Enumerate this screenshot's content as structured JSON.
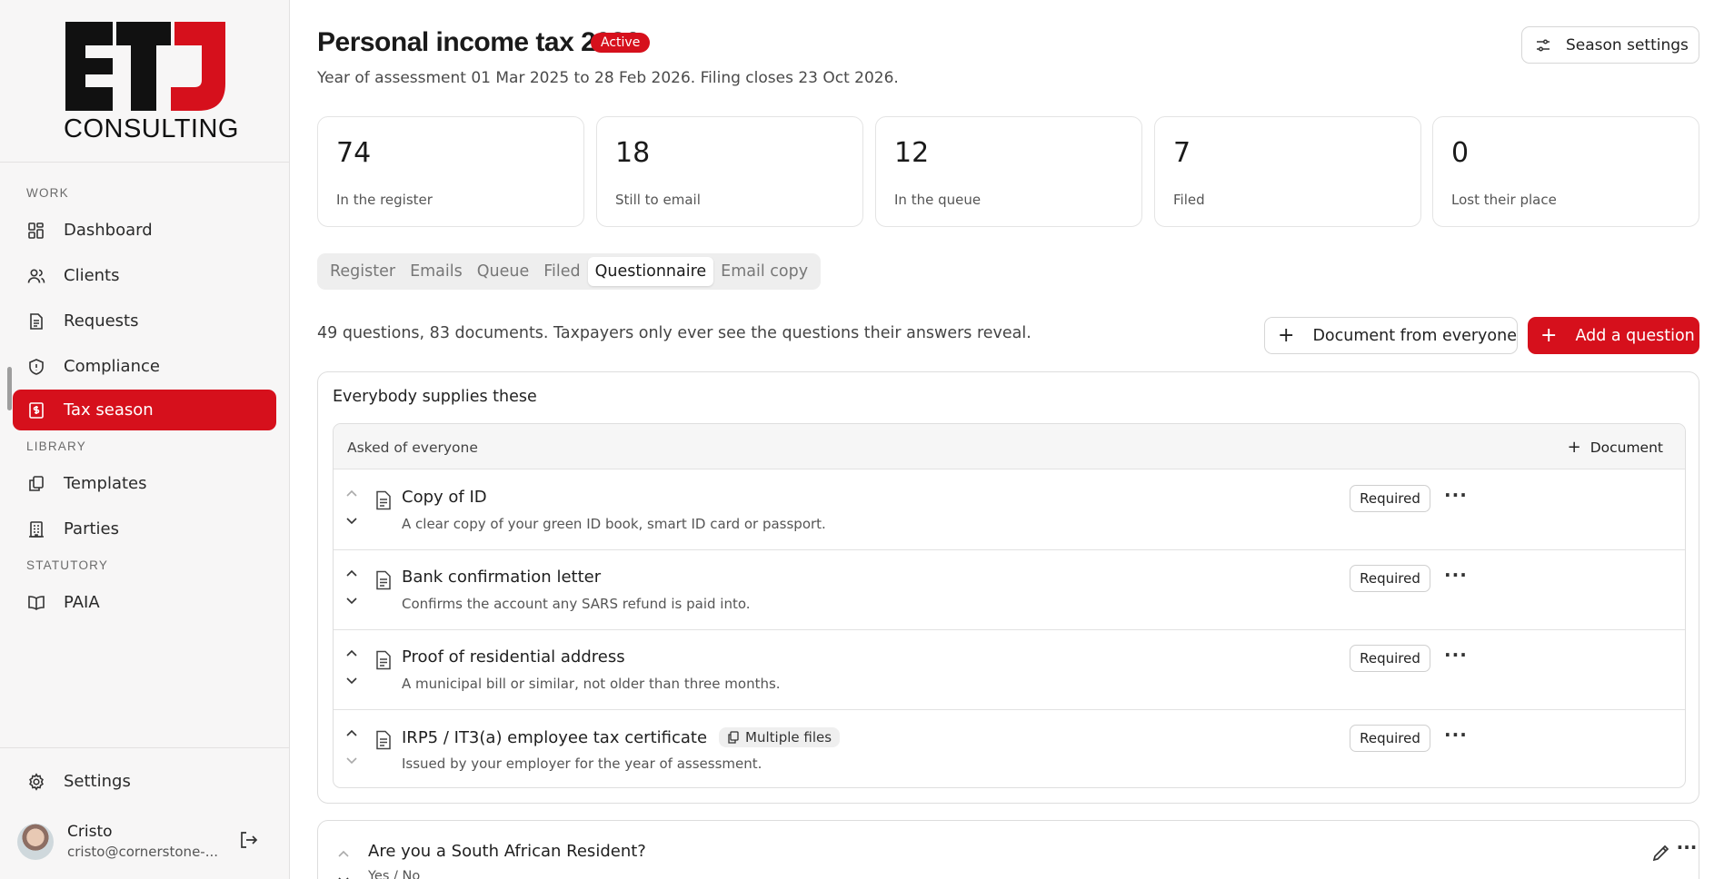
{
  "brand": {
    "logo_letters": "ETJ",
    "logo_word": "CONSULTING",
    "accent_color": "#d6101c"
  },
  "sidebar": {
    "sections": {
      "work": "WORK",
      "library": "LIBRARY",
      "statutory": "STATUTORY"
    },
    "items": [
      {
        "label": "Dashboard",
        "icon": "dashboard-icon"
      },
      {
        "label": "Clients",
        "icon": "users-icon"
      },
      {
        "label": "Requests",
        "icon": "document-icon"
      },
      {
        "label": "Compliance",
        "icon": "shield-icon"
      },
      {
        "label": "Tax season",
        "icon": "dollar-document-icon",
        "active": true
      },
      {
        "label": "Templates",
        "icon": "copy-icon"
      },
      {
        "label": "Parties",
        "icon": "building-icon"
      },
      {
        "label": "PAIA",
        "icon": "book-icon"
      }
    ],
    "settings_label": "Settings",
    "user": {
      "name": "Cristo",
      "email": "cristo@cornerstone-..."
    }
  },
  "header": {
    "title": "Personal income tax 2026",
    "status_badge": "Active",
    "subtitle": "Year of assessment 01 Mar 2025 to 28 Feb 2026. Filing closes 23 Oct 2026.",
    "season_settings_label": "Season settings"
  },
  "stats": [
    {
      "value": "74",
      "label": "In the register"
    },
    {
      "value": "18",
      "label": "Still to email"
    },
    {
      "value": "12",
      "label": "In the queue"
    },
    {
      "value": "7",
      "label": "Filed"
    },
    {
      "value": "0",
      "label": "Lost their place"
    }
  ],
  "tabs": [
    {
      "label": "Register"
    },
    {
      "label": "Emails"
    },
    {
      "label": "Queue"
    },
    {
      "label": "Filed"
    },
    {
      "label": "Questionnaire",
      "active": true
    },
    {
      "label": "Email copy"
    }
  ],
  "questionnaire": {
    "summary": "49 questions, 83 documents. Taxpayers only ever see the questions their answers reveal.",
    "doc_everyone_label": "Document from everyone",
    "add_question_label": "Add a question",
    "group": {
      "title": "Everybody supplies these",
      "inner_label": "Asked of everyone",
      "add_document_label": "Document",
      "documents": [
        {
          "title": "Copy of ID",
          "description": "A clear copy of your green ID book, smart ID card or passport.",
          "required_label": "Required",
          "multiple_files": null
        },
        {
          "title": "Bank confirmation letter",
          "description": "Confirms the account any SARS refund is paid into.",
          "required_label": "Required",
          "multiple_files": null
        },
        {
          "title": "Proof of residential address",
          "description": "A municipal bill or similar, not older than three months.",
          "required_label": "Required",
          "multiple_files": null
        },
        {
          "title": "IRP5 / IT3(a) employee tax certificate",
          "description": "Issued by your employer for the year of assessment.",
          "required_label": "Required",
          "multiple_files": "Multiple files"
        }
      ]
    },
    "question": {
      "title": "Are you a South African Resident?",
      "answer_type": "Yes / No"
    }
  }
}
